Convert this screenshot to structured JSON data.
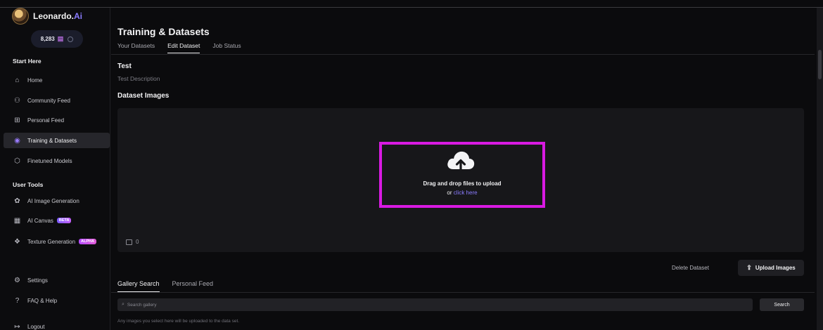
{
  "brand": {
    "name": "Leonardo.",
    "suffix": "Ai",
    "credits": "8,283"
  },
  "sidebar": {
    "start_title": "Start Here",
    "start_items": [
      {
        "label": "Home",
        "icon": "home-icon"
      },
      {
        "label": "Community Feed",
        "icon": "community-icon"
      },
      {
        "label": "Personal Feed",
        "icon": "grid-icon"
      },
      {
        "label": "Training & Datasets",
        "icon": "training-icon",
        "active": true
      },
      {
        "label": "Finetuned Models",
        "icon": "cube-icon"
      }
    ],
    "tools_title": "User Tools",
    "tool_items": [
      {
        "label": "AI Image Generation",
        "icon": "image-gen-icon"
      },
      {
        "label": "AI Canvas",
        "icon": "canvas-icon",
        "badge": "BETA"
      },
      {
        "label": "Texture Generation",
        "icon": "texture-icon",
        "badge": "ALPHA"
      }
    ],
    "bottom_items": [
      {
        "label": "Settings",
        "icon": "gear-icon"
      },
      {
        "label": "FAQ & Help",
        "icon": "help-icon"
      },
      {
        "label": "Logout",
        "icon": "logout-icon"
      }
    ]
  },
  "header": {
    "title": "Training & Datasets",
    "tabs": [
      "Your Datasets",
      "Edit Dataset",
      "Job Status"
    ],
    "active_tab": "Edit Dataset"
  },
  "dataset": {
    "name": "Test",
    "description": "Test Description",
    "images_title": "Dataset Images",
    "drop_text": "Drag and drop files to upload",
    "or_text": "or",
    "click_text": "click here",
    "image_count": "0"
  },
  "actions": {
    "delete": "Delete Dataset",
    "upload": "Upload Images"
  },
  "gallery": {
    "tabs": [
      "Gallery Search",
      "Personal Feed"
    ],
    "active_tab": "Gallery Search",
    "search_placeholder": "Search gallery",
    "search_button": "Search",
    "hint": "Any images you select here will be uploaded to the data set."
  },
  "colors": {
    "accent": "#8b7cff",
    "highlight": "#d81ae2",
    "background": "#0b0b0d"
  }
}
